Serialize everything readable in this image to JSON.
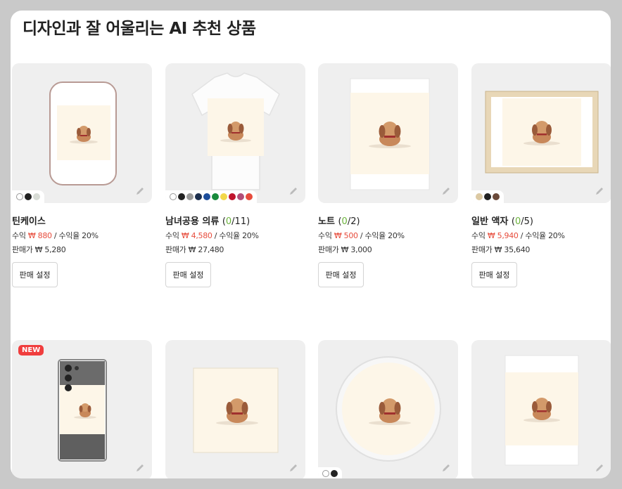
{
  "page": {
    "title": "디자인과 잘 어울리는 AI 추천 상품"
  },
  "products": [
    {
      "name": "틴케이스",
      "count": "",
      "profit_prefix": "수익 ",
      "profit": "₩ 880",
      "profit_rate": " / 수익율 20%",
      "price": "판매가 ₩ 5,280",
      "button": "판매 설정",
      "swatches": [
        "#ffffff",
        "#222222",
        "#d8dcd6"
      ]
    },
    {
      "name": "남녀공용 의류 ",
      "count_open": "(",
      "count_done": "0",
      "count_total": "/11)",
      "profit_prefix": "수익 ",
      "profit": "₩ 4,580",
      "profit_rate": " / 수익율 20%",
      "price": "판매가 ₩ 27,480",
      "button": "판매 설정",
      "swatches": [
        "#ffffff",
        "#222222",
        "#9a9a9a",
        "#1c2f4e",
        "#1d4e9b",
        "#188a3c",
        "#f2d84a",
        "#c0142d",
        "#b24e78",
        "#e74c3c"
      ]
    },
    {
      "name": "노트 ",
      "count_open": "(",
      "count_done": "0",
      "count_total": "/2)",
      "profit_prefix": "수익 ",
      "profit": "₩ 500",
      "profit_rate": " / 수익율 20%",
      "price": "판매가 ₩ 3,000",
      "button": "판매 설정",
      "swatches": []
    },
    {
      "name": "일반 액자 ",
      "count_open": "(",
      "count_done": "0",
      "count_total": "/5)",
      "profit_prefix": "수익 ",
      "profit": "₩ 5,940",
      "profit_rate": " / 수익율 20%",
      "price": "판매가 ₩ 35,640",
      "button": "판매 설정",
      "swatches": [
        "#dcc9a3",
        "#222222",
        "#6b4a3a"
      ]
    }
  ],
  "row2": {
    "new_badge": "NEW",
    "coaster_swatches": [
      "#ffffff",
      "#222222"
    ]
  },
  "colors": {
    "accent_green": "#6bb33b",
    "profit_red": "#e74c3c",
    "new_badge": "#f03e3e"
  }
}
